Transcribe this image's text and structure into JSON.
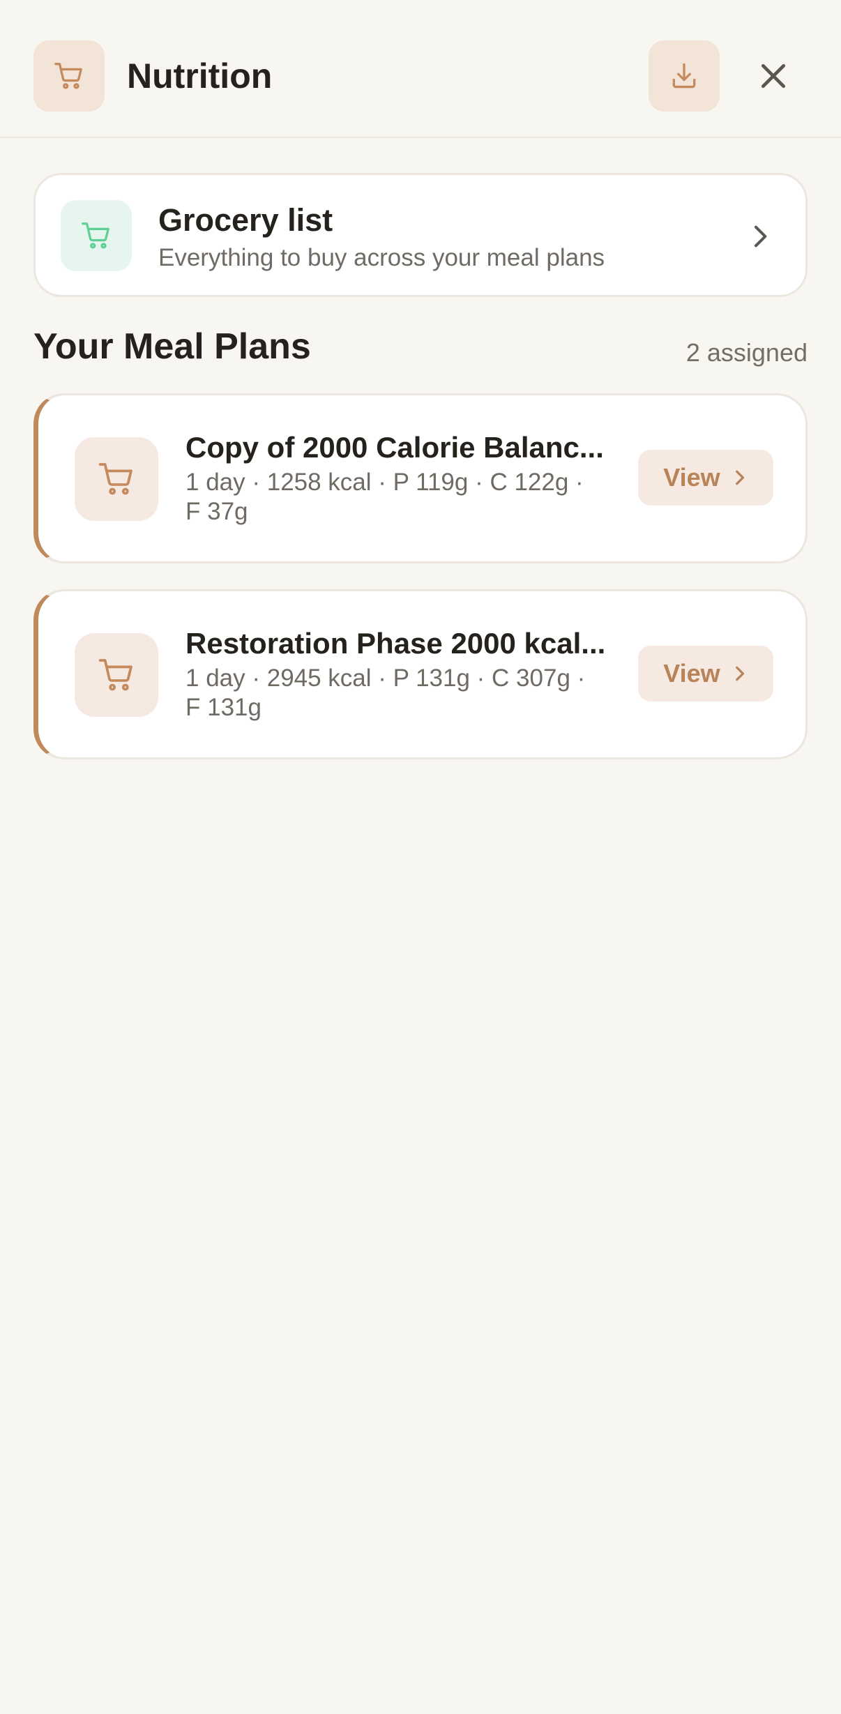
{
  "header": {
    "title": "Nutrition",
    "icon": "cart-icon",
    "download_icon": "download-icon",
    "close_icon": "close-icon"
  },
  "grocery": {
    "title": "Grocery list",
    "subtitle": "Everything to buy across your meal plans",
    "icon": "cart-icon"
  },
  "meal_plans": {
    "heading": "Your Meal Plans",
    "count_label": "2 assigned",
    "items": [
      {
        "title": "Copy of 2000 Calorie Balanc...",
        "meta": "1 day · 1258 kcal · P 119g · C 122g · F 37g",
        "view_label": "View"
      },
      {
        "title": "Restoration Phase 2000 kcal...",
        "meta": "1 day · 2945 kcal · P 131g · C 307g · F 131g",
        "view_label": "View"
      }
    ]
  },
  "colors": {
    "background": "#f8f6f1",
    "accent": "#c0895c",
    "accent_soft": "#f3e4d8",
    "green": "#5fcf95",
    "green_soft": "#e6f6ee"
  }
}
